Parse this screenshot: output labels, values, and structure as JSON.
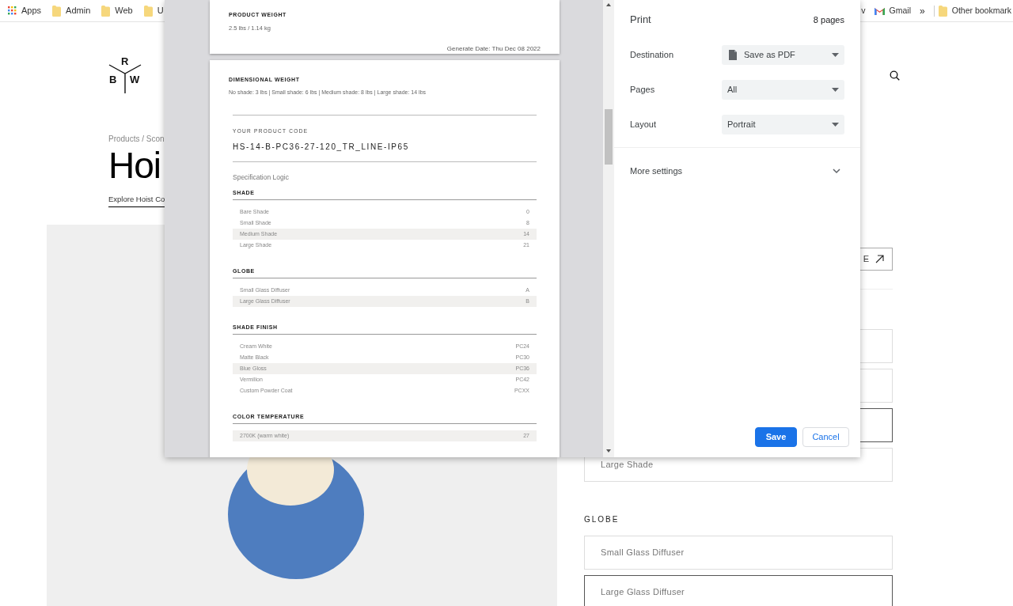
{
  "bookmarks_bar": {
    "left": [
      {
        "kind": "apps",
        "label": "Apps"
      },
      {
        "kind": "folder",
        "label": "Admin"
      },
      {
        "kind": "folder",
        "label": "Web"
      },
      {
        "kind": "folder",
        "label": "U"
      }
    ],
    "right": [
      {
        "kind": "plain",
        "label": "v"
      },
      {
        "kind": "gmail",
        "label": "Gmail"
      },
      {
        "kind": "overflow",
        "label": "»"
      },
      {
        "kind": "folder",
        "label": "Other bookmark"
      }
    ]
  },
  "page": {
    "logo": [
      "R",
      "B",
      "W"
    ],
    "breadcrumb": "Products / Scon",
    "title": "Hoi",
    "explore_link": "Explore Hoist Co",
    "cta_button": "E",
    "shade_options": [
      {
        "selected": false
      },
      {
        "selected": false
      },
      {
        "selected": true
      },
      {
        "label": "Large Shade",
        "selected": false
      }
    ],
    "globe": {
      "heading": "GLOBE",
      "options": [
        {
          "label": "Small Glass Diffuser",
          "selected": false
        },
        {
          "label": "Large Glass Diffuser",
          "selected": true
        }
      ]
    }
  },
  "print_dialog": {
    "preview": {
      "page_1": {
        "heading": "PRODUCT WEIGHT",
        "text": "2.5 lbs / 1.14 kg",
        "generate_date": "Generate Date: Thu Dec 08 2022"
      },
      "page_2": {
        "heading": "DIMENSIONAL WEIGHT",
        "text": "No shade: 3 lbs | Small shade: 6 lbs | Medium shade: 8 lbs | Large shade: 14 lbs",
        "code_label": "YOUR PRODUCT CODE",
        "code": "HS-14-B-PC36-27-120_TR_LINE-IP65",
        "spec_title": "Specification Logic",
        "sections": [
          {
            "heading": "SHADE",
            "rows": [
              {
                "label": "Bare Shade",
                "code": "0",
                "selected": false
              },
              {
                "label": "Small Shade",
                "code": "8",
                "selected": false
              },
              {
                "label": "Medium Shade",
                "code": "14",
                "selected": true
              },
              {
                "label": "Large Shade",
                "code": "21",
                "selected": false
              }
            ]
          },
          {
            "heading": "GLOBE",
            "rows": [
              {
                "label": "Small Glass Diffuser",
                "code": "A",
                "selected": false
              },
              {
                "label": "Large Glass Diffuser",
                "code": "B",
                "selected": true
              }
            ]
          },
          {
            "heading": "SHADE FINISH",
            "rows": [
              {
                "label": "Cream White",
                "code": "PC24",
                "selected": false
              },
              {
                "label": "Matte Black",
                "code": "PC30",
                "selected": false
              },
              {
                "label": "Blue Gloss",
                "code": "PC36",
                "selected": true
              },
              {
                "label": "Vermilion",
                "code": "PC42",
                "selected": false
              },
              {
                "label": "Custom Powder Coat",
                "code": "PCXX",
                "selected": false
              }
            ]
          },
          {
            "heading": "COLOR TEMPERATURE",
            "rows": [
              {
                "label": "2700K (warm white)",
                "code": "27",
                "selected": true
              }
            ]
          }
        ]
      }
    },
    "title": "Print",
    "page_count": "8 pages",
    "settings": [
      {
        "label": "Destination",
        "value": "Save as PDF",
        "kind": "pdf"
      },
      {
        "label": "Pages",
        "value": "All",
        "kind": "plain"
      },
      {
        "label": "Layout",
        "value": "Portrait",
        "kind": "plain"
      }
    ],
    "more_settings": {
      "label": "More settings",
      "expanded": false
    },
    "buttons": [
      {
        "label": "Save",
        "kind": "primary"
      },
      {
        "label": "Cancel",
        "kind": "secondary"
      }
    ]
  }
}
